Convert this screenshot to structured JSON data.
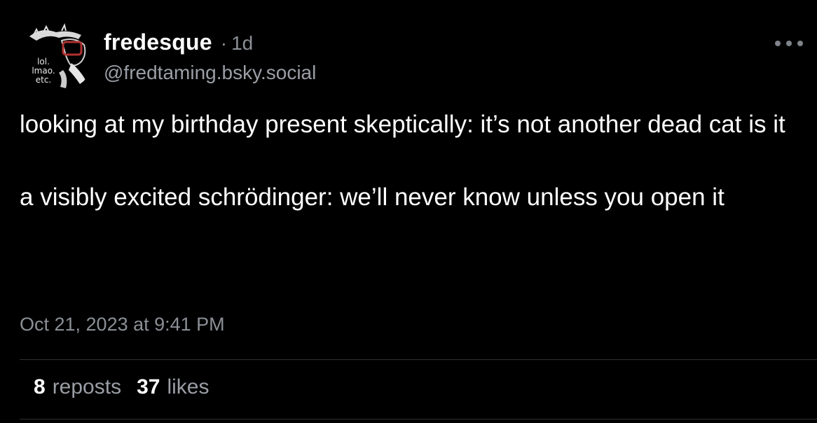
{
  "post": {
    "author": {
      "display_name": "fredesque",
      "separator": "·",
      "age": "1d",
      "handle": "@fredtaming.bsky.social",
      "avatar_text": [
        "lol.",
        "lmao.",
        "etc."
      ]
    },
    "body": {
      "paragraph_1": "looking at my birthday present skeptically: it’s not another dead cat is it",
      "paragraph_2": "a visibly excited schrödinger: we’ll never know unless you open it"
    },
    "timestamp": "Oct 21, 2023 at 9:41 PM",
    "stats": {
      "reposts_count": "8",
      "reposts_label": "reposts",
      "likes_count": "37",
      "likes_label": "likes"
    },
    "colors": {
      "background": "#000000",
      "text": "#ffffff",
      "muted": "#8b8f96",
      "divider": "#2c2f33"
    },
    "icons": {
      "more": "more-horizontal-icon"
    }
  }
}
